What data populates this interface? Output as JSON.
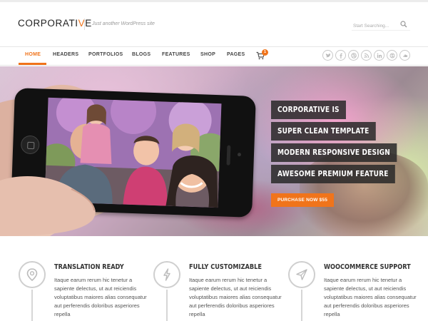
{
  "header": {
    "logo_main": "CORPORATI",
    "logo_accent": "V",
    "logo_end": "E",
    "tagline": "Just another WordPress site",
    "search_placeholder": "Start Searching..."
  },
  "nav": {
    "items": [
      "HOME",
      "HEADERS",
      "PORTFOLIOS",
      "BLOGS",
      "FEATURES",
      "SHOP",
      "PAGES"
    ],
    "active": "HOME",
    "cart_count": "1",
    "social_icons": [
      "twitter-icon",
      "facebook-icon",
      "dribbble-icon",
      "rss-icon",
      "linkedin-icon",
      "skype-icon",
      "soundcloud-icon"
    ]
  },
  "hero": {
    "tags": [
      "CORPORATIVE IS",
      "SUPER CLEAN TEMPLATE",
      "MODERN RESPONSIVE DESIGN",
      "AWESOME PREMIUM FEATURE"
    ],
    "button": "PURCHASE NOW $55"
  },
  "features": [
    {
      "icon": "map-pin-icon",
      "title": "TRANSLATION READY",
      "text": "Itaque earum rerum hic tenetur a sapiente delectus, ut aut reiciendis voluptatibus maiores alias consequatur aut perferendis doloribus asperiores repella"
    },
    {
      "icon": "lightning-icon",
      "title": "FULLY CUSTOMIZABLE",
      "text": "Itaque earum rerum hic tenetur a sapiente delectus, ut aut reiciendis voluptatibus maiores alias consequatur aut perferendis doloribus asperiores repella"
    },
    {
      "icon": "paper-plane-icon",
      "title": "WOOCOMMERCE SUPPORT",
      "text": "Itaque earum rerum hic tenetur a sapiente delectus, ut aut reiciendis voluptatibus maiores alias consequatur aut perferendis doloribus asperiores repella"
    }
  ],
  "colors": {
    "accent": "#f0741b",
    "tag_bg": "#2b2b2b"
  }
}
